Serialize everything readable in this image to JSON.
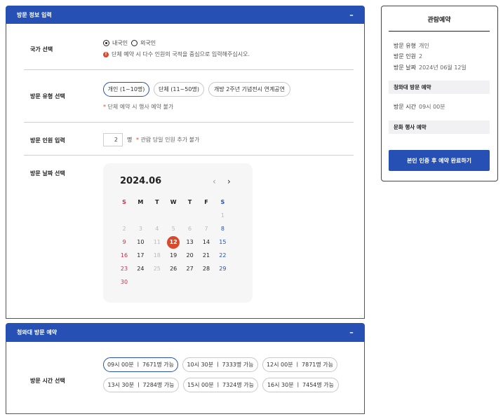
{
  "visit_info": {
    "header": "방문 정보 입력",
    "collapse_icon": "–",
    "country": {
      "label": "국가 선택",
      "options": [
        {
          "label": "내국인",
          "selected": true
        },
        {
          "label": "외국인",
          "selected": false
        }
      ],
      "notice": "단체 예약 시 다수 인원의 국적을 중심으로 입력해주십시오."
    },
    "type": {
      "label": "방문 유형 선택",
      "options": [
        {
          "label": "개인 (1~10명)",
          "selected": true
        },
        {
          "label": "단체 (11~50명)",
          "selected": false
        },
        {
          "label": "개방 2주년 기념전시 연계공연",
          "selected": false
        }
      ],
      "note": "단체 예약 시 행사 예약 불가"
    },
    "people": {
      "label": "방문 인원 입력",
      "value": "2",
      "unit": "명",
      "note": "관람 당일 인원 추가 불가"
    },
    "date": {
      "label": "방문 날짜 선택",
      "month_title": "2024.06",
      "prev_icon": "‹",
      "next_icon": "›",
      "weekdays": [
        "S",
        "M",
        "T",
        "W",
        "T",
        "F",
        "S"
      ],
      "weeks": [
        [
          "",
          "",
          "",
          "",
          "",
          "",
          "1"
        ],
        [
          "2",
          "3",
          "4",
          "5",
          "6",
          "7",
          "8"
        ],
        [
          "9",
          "10",
          "11",
          "12",
          "13",
          "14",
          "15"
        ],
        [
          "16",
          "17",
          "18",
          "19",
          "20",
          "21",
          "22"
        ],
        [
          "23",
          "24",
          "25",
          "26",
          "27",
          "28",
          "29"
        ],
        [
          "30",
          "",
          "",
          "",
          "",
          "",
          ""
        ]
      ],
      "disabled_days": [
        "1",
        "2",
        "3",
        "4",
        "5",
        "6",
        "7",
        "11",
        "18",
        "25"
      ],
      "selected_day": "12"
    }
  },
  "cheongwadae": {
    "header": "청와대 방문 예약",
    "collapse_icon": "–",
    "time_label": "방문 시간 선택",
    "slots": [
      {
        "label": "09시 00분 ㅣ 7671명 가능",
        "selected": true
      },
      {
        "label": "10시 30분 ㅣ 7333명 가능",
        "selected": false
      },
      {
        "label": "12시 00분 ㅣ 7871명 가능",
        "selected": false
      },
      {
        "label": "13시 30분 ㅣ 7284명 가능",
        "selected": false
      },
      {
        "label": "15시 00분 ㅣ 7324명 가능",
        "selected": false
      },
      {
        "label": "16시 30분 ㅣ 7454명 가능",
        "selected": false
      }
    ]
  },
  "summary": {
    "title": "관람예약",
    "type_key": "방문 유형",
    "type_val": "개인",
    "people_key": "방문 인원",
    "people_val": "2",
    "date_key": "방문 날짜",
    "date_val": "2024년 06월 12일",
    "cheong_band": "청와대 방문 예약",
    "time_key": "방문 시간",
    "time_val": "09시 00분",
    "culture_band": "문화 행사 예약",
    "submit": "본인 인증 후 예약 완료하기"
  },
  "colors": {
    "accent": "#2650b4",
    "warning": "#d84a2c",
    "sunday": "#c8334b"
  }
}
